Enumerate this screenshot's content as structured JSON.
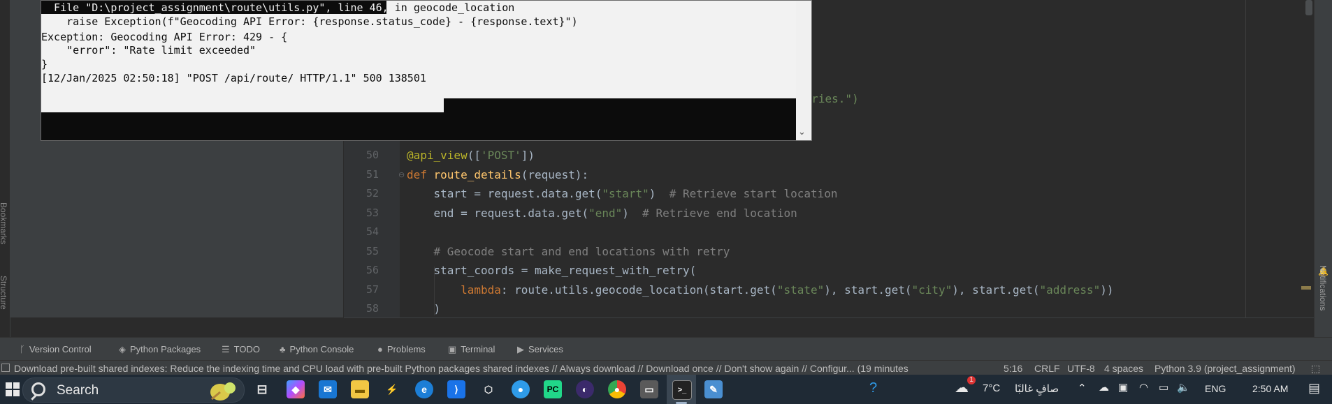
{
  "terminal": {
    "lines": [
      "  File \"D:\\project_assignment\\route\\utils.py\", line 46,",
      "    raise Exception(f\"Geocoding API Error: {response.status_code} - {response.text}\")",
      "Exception: Geocoding API Error: 429 - {",
      "    \"error\": \"Rate limit exceeded\"",
      "}",
      "[12/Jan/2025 02:50:18] \"POST /api/route/ HTTP/1.1\" 500 138501"
    ],
    "line0_tail": " in geocode_location"
  },
  "editor": {
    "partial_text": "etries.\")",
    "line_numbers": [
      "50",
      "51",
      "52",
      "53",
      "54",
      "55",
      "56",
      "57",
      "58"
    ],
    "code": {
      "l50_deco": "@api_view",
      "l50_a": "([",
      "l50_str": "'POST'",
      "l50_b": "])",
      "l51_kw": "def ",
      "l51_fn": "route_details",
      "l51_rest": "(request):",
      "l52_a": "    start = request.data.get(",
      "l52_str": "\"start\"",
      "l52_b": ")  ",
      "l52_cm": "# Retrieve start location",
      "l53_a": "    end = request.data.get(",
      "l53_str": "\"end\"",
      "l53_b": ")  ",
      "l53_cm": "# Retrieve end location",
      "l55_cm": "    # Geocode start and end locations with retry",
      "l56": "    start_coords = make_request_with_retry(",
      "l57_kw": "        lambda",
      "l57_a": ": route.utils.geocode_location(start.get(",
      "l57_s1": "\"state\"",
      "l57_b": "), start.get(",
      "l57_s2": "\"city\"",
      "l57_c": "), start.get(",
      "l57_s3": "\"address\"",
      "l57_d": "))",
      "l58": "    )"
    }
  },
  "side_tabs": {
    "bookmarks": "Bookmarks",
    "structure": "Structure",
    "notifications": "Notifications"
  },
  "toolbar": {
    "items": [
      {
        "label": "Version Control",
        "icon": "branch-icon"
      },
      {
        "label": "Python Packages",
        "icon": "layers-icon"
      },
      {
        "label": "TODO",
        "icon": "list-icon"
      },
      {
        "label": "Python Console",
        "icon": "python-icon"
      },
      {
        "label": "Problems",
        "icon": "warning-icon"
      },
      {
        "label": "Terminal",
        "icon": "terminal-icon"
      },
      {
        "label": "Services",
        "icon": "services-icon"
      }
    ]
  },
  "status": {
    "message": "Download pre-built shared indexes: Reduce the indexing time and CPU load with pre-built Python packages shared indexes // Always download // Download once // Don't show again // Configur... (19 minutes",
    "position": "5:16",
    "line_sep": "CRLF",
    "encoding": "UTF-8",
    "indent": "4 spaces",
    "interpreter": "Python 3.9 (project_assignment)"
  },
  "taskbar": {
    "search_placeholder": "Search",
    "weather_temp": "7°C",
    "weather_desc": "صافٍ غالبًا",
    "notif_count": "1",
    "lang": "ENG",
    "time": "2:50 AM"
  },
  "colors": {
    "editor_bg": "#2b2b2b",
    "keyword": "#cc7832",
    "string": "#6a8759",
    "comment": "#808080",
    "decorator": "#bbb529",
    "function": "#ffc66d",
    "taskbar_bg": "#1f2a35"
  }
}
